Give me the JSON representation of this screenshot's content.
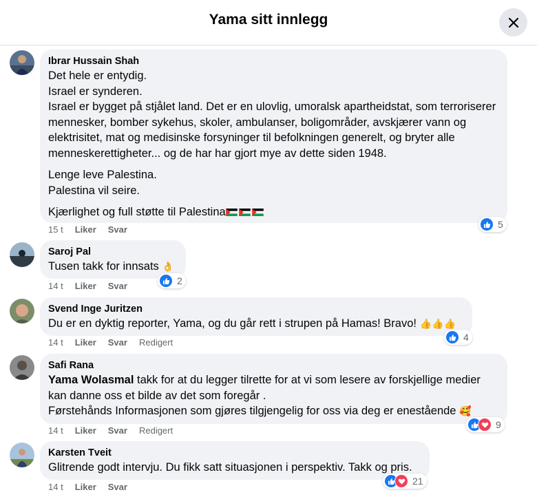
{
  "header": {
    "title": "Yama sitt innlegg"
  },
  "actions": {
    "like": "Liker",
    "reply": "Svar",
    "edited": "Redigert"
  },
  "comments": [
    {
      "author": "Ibrar Hussain Shah",
      "paragraphs": [
        "Det hele er entydig.",
        "Israel er synderen.",
        "Israel er bygget på stjålet land. Det er en ulovlig, umoralsk apartheidstat, som terroriserer mennesker, bomber sykehus, skoler, ambulanser, boligområder, avskjærer vann og elektrisitet, mat og medisinske forsyninger til befolkningen generelt, og bryter alle menneskerettigheter... og de har har gjort mye av dette siden 1948.",
        "Lenge leve Palestina.",
        "Palestina vil seire.",
        "Kjærlighet og full støtte til Palestina"
      ],
      "time": "15 t",
      "reaction_count": "5"
    },
    {
      "author": "Saroj Pal",
      "text": "Tusen takk for innsats",
      "emoji": "👌",
      "time": "14 t",
      "reaction_count": "2"
    },
    {
      "author": "Svend Inge Juritzen",
      "text": "Du er en dyktig reporter, Yama, og du går rett i strupen på Hamas! Bravo!",
      "emoji": "👍👍👍",
      "time": "14 t",
      "reaction_count": "4"
    },
    {
      "author": "Safi Rana",
      "mention": "Yama Wolasmal",
      "text1": " takk for at du legger tilrette for at vi som lesere av forskjellige medier kan danne oss et bilde av det som foregår .",
      "text2": "Førstehånds Informasjonen som gjøres tilgjengelig for oss via deg er enestående",
      "emoji": "🥰",
      "time": "14 t",
      "reaction_count": "9"
    },
    {
      "author": "Karsten Tveit",
      "text": "Glitrende godt intervju. Du fikk satt situasjonen i perspektiv. Takk og pris.",
      "time": "14 t",
      "reaction_count": "21"
    }
  ],
  "colors": {
    "accent": "#1877f2",
    "love": "#f33e58",
    "bubble": "#f0f2f5",
    "meta": "#65676b"
  },
  "icons": [
    "close-icon",
    "like-icon",
    "love-icon",
    "palestine-flag-icon"
  ]
}
